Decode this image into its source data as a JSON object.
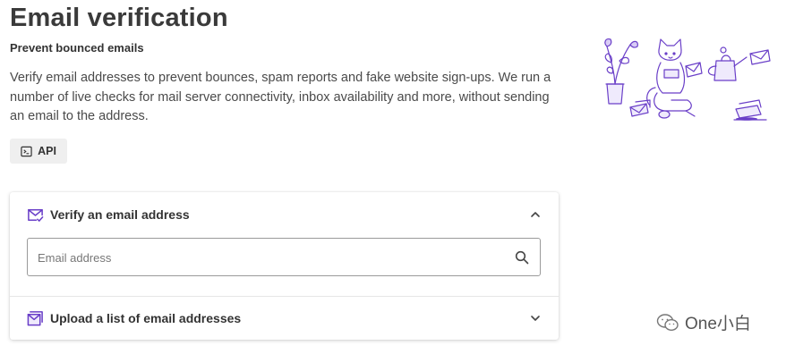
{
  "header": {
    "title": "Email verification",
    "subtitle": "Prevent bounced emails",
    "description": "Verify email addresses to prevent bounces, spam reports and fake website sign-ups. We run a number of live checks for mail server connectivity, inbox availability and more, without sending an email to the address."
  },
  "api_button": {
    "label": "API",
    "icon": "terminal-icon"
  },
  "accordion": {
    "verify": {
      "label": "Verify an email address",
      "icon": "mail-check-icon",
      "expanded": true
    },
    "search": {
      "placeholder": "Email address",
      "value": "",
      "icon": "search-icon"
    },
    "upload": {
      "label": "Upload a list of email addresses",
      "icon": "mail-stack-icon",
      "expanded": false
    }
  },
  "watermark": {
    "text": "One小白"
  },
  "colors": {
    "accent": "#6a3fc8",
    "text": "#333333",
    "border": "#9a9a9a"
  }
}
